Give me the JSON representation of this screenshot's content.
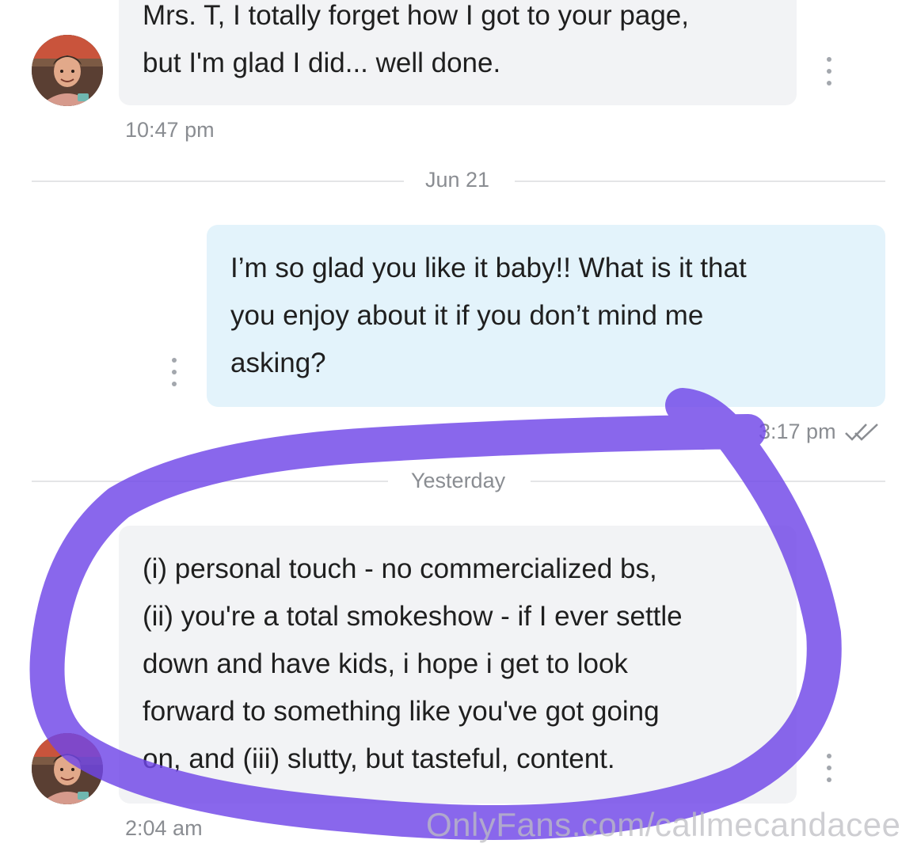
{
  "chat": {
    "message_1": {
      "lines": [
        "Mrs. T, I totally forget how I got to your page,",
        "but I'm glad I did... well done."
      ],
      "time": "10:47 pm"
    },
    "separator_1": "Jun 21",
    "message_2": {
      "lines": [
        "I’m so glad you like it baby!! What is it that",
        "you enjoy about it if you don’t mind me",
        "asking?"
      ],
      "time": "3:17 pm"
    },
    "separator_2": "Yesterday",
    "message_3": {
      "lines": [
        "(i) personal touch - no commercialized bs,",
        "(ii) you're a total smokeshow - if I ever settle",
        "down and have kids, i hope i get to look",
        "forward to something like you've got going",
        "on, and (iii) slutty, but tasteful, content."
      ],
      "time": "2:04 am"
    }
  },
  "watermark": "OnlyFans.com/callmecandacee",
  "icons": {
    "more": "kebab-vertical-icon",
    "read_receipt": "double-check-icon",
    "avatar": "user-avatar-photo"
  },
  "colors": {
    "incoming_bubble": "#f2f3f5",
    "outgoing_bubble": "#e3f3fb",
    "annotation_marker": "#6f45e8",
    "timestamp": "#8a8d92"
  }
}
